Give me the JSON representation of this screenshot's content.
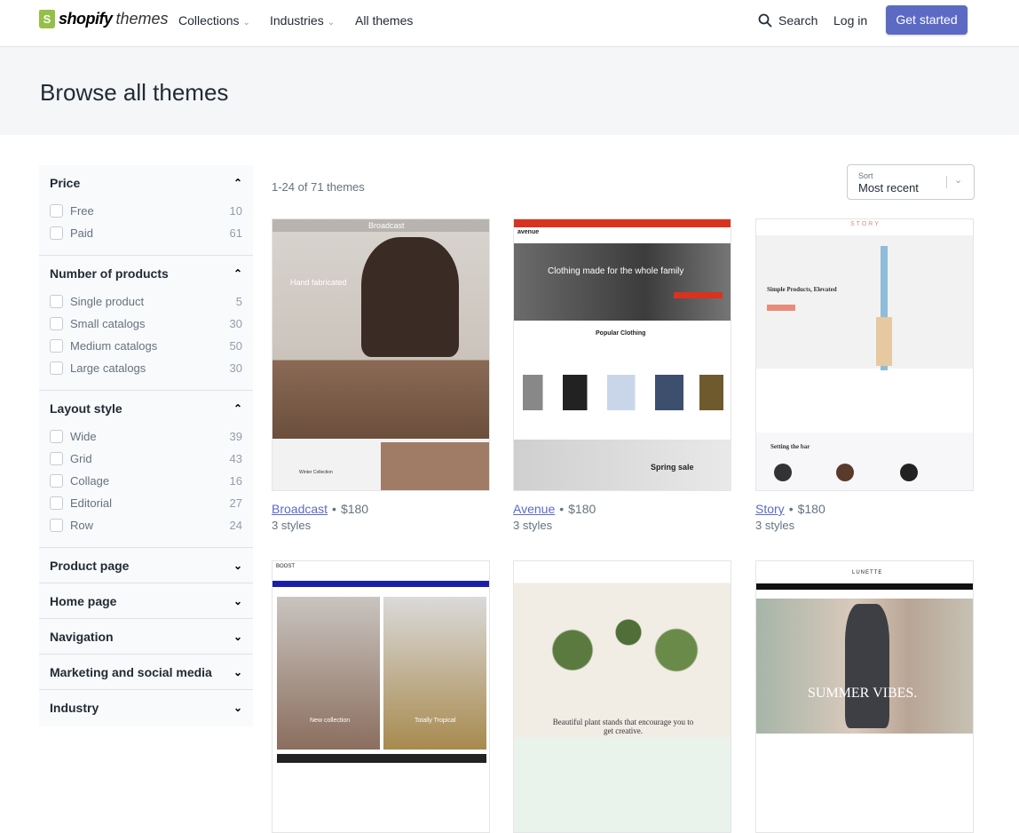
{
  "header": {
    "logo_bold": "shopify",
    "logo_light": "themes",
    "nav": [
      {
        "label": "Collections",
        "dropdown": true
      },
      {
        "label": "Industries",
        "dropdown": true
      },
      {
        "label": "All themes",
        "dropdown": false
      }
    ],
    "search": "Search",
    "login": "Log in",
    "cta": "Get started",
    "accent": "#5c6ac4"
  },
  "page": {
    "title": "Browse all themes",
    "count": "1-24 of 71 themes",
    "sort_label": "Sort",
    "sort_value": "Most recent"
  },
  "filters": [
    {
      "title": "Price",
      "expanded": true,
      "options": [
        {
          "label": "Free",
          "count": "10"
        },
        {
          "label": "Paid",
          "count": "61"
        }
      ]
    },
    {
      "title": "Number of products",
      "expanded": true,
      "options": [
        {
          "label": "Single product",
          "count": "5"
        },
        {
          "label": "Small catalogs",
          "count": "30"
        },
        {
          "label": "Medium catalogs",
          "count": "50"
        },
        {
          "label": "Large catalogs",
          "count": "30"
        }
      ]
    },
    {
      "title": "Layout style",
      "expanded": true,
      "options": [
        {
          "label": "Wide",
          "count": "39"
        },
        {
          "label": "Grid",
          "count": "43"
        },
        {
          "label": "Collage",
          "count": "16"
        },
        {
          "label": "Editorial",
          "count": "27"
        },
        {
          "label": "Row",
          "count": "24"
        }
      ]
    },
    {
      "title": "Product page",
      "expanded": false
    },
    {
      "title": "Home page",
      "expanded": false
    },
    {
      "title": "Navigation",
      "expanded": false
    },
    {
      "title": "Marketing and social media",
      "expanded": false
    },
    {
      "title": "Industry",
      "expanded": false
    }
  ],
  "themes": [
    {
      "name": "Broadcast",
      "price": "$180",
      "styles": "3 styles",
      "preview_text": [
        "Broadcast",
        "Hand fabricated",
        "Winter Collection"
      ]
    },
    {
      "name": "Avenue",
      "price": "$180",
      "styles": "3 styles",
      "preview_text": [
        "avenue",
        "Clothing made for the whole family",
        "Popular Clothing",
        "Spring sale"
      ]
    },
    {
      "name": "Story",
      "price": "$180",
      "styles": "3 styles",
      "preview_text": [
        "STORY",
        "Simple Products, Elevated",
        "Setting the bar"
      ]
    },
    {
      "preview_text": [
        "BOOST",
        "New collection",
        "Totally Tropical"
      ]
    },
    {
      "preview_text": [
        "Beautiful plant stands that encourage you to get creative."
      ]
    },
    {
      "preview_text": [
        "LUNETTE",
        "SUMMER VIBES."
      ]
    }
  ]
}
